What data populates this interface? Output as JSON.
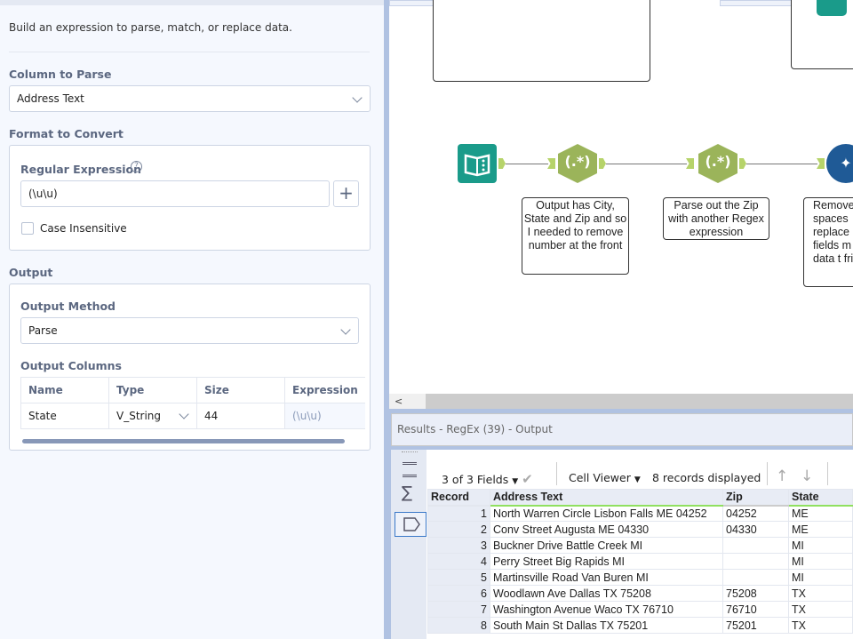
{
  "config": {
    "description": "Build an expression to parse, match, or replace data.",
    "column_to_parse_label": "Column to Parse",
    "column_to_parse_value": "Address Text",
    "format_label": "Format to Convert",
    "regex_label": "Regular Expression",
    "help_icon": "?",
    "regex_value": "(\\u\\u)",
    "add_label": "+",
    "case_insensitive_label": "Case Insensitive",
    "output_label": "Output",
    "output_method_label": "Output Method",
    "output_method_value": "Parse",
    "output_columns_label": "Output Columns",
    "columns_headers": [
      "Name",
      "Type",
      "Size",
      "Expression"
    ],
    "columns_rows": [
      {
        "name": "State",
        "type": "V_String",
        "size": "44",
        "expression": "(\\u\\u)"
      }
    ]
  },
  "canvas": {
    "regex_glyph": "(.*)",
    "notes": [
      "Output has City, State and Zip and so I needed to remove number at the front",
      "Parse out the Zip with another Regex expression",
      "Remove spaces replace fields m data t frie"
    ],
    "scroll_left": "<"
  },
  "results": {
    "title": "Results - RegEx (39) - Output",
    "fields": "3 of 3 Fields",
    "viewer": "Cell Viewer",
    "records_displayed": "8 records displayed",
    "headers": [
      "Record",
      "Address Text",
      "Zip",
      "State"
    ],
    "rows": [
      [
        "1",
        "North Warren Circle Lisbon Falls ME 04252",
        "04252",
        "ME"
      ],
      [
        "2",
        "Conv Street Augusta ME 04330",
        "04330",
        "ME"
      ],
      [
        "3",
        "Buckner Drive Battle Creek MI",
        "",
        "MI"
      ],
      [
        "4",
        "Perry Street Big Rapids MI",
        "",
        "MI"
      ],
      [
        "5",
        "Martinsville Road Van Buren MI",
        "",
        "MI"
      ],
      [
        "6",
        "Woodlawn Ave Dallas TX 75208",
        "75208",
        "TX"
      ],
      [
        "7",
        "Washington Avenue Waco TX 76710",
        "76710",
        "TX"
      ],
      [
        "8",
        "South Main St Dallas TX 75201",
        "75201",
        "TX"
      ]
    ]
  }
}
